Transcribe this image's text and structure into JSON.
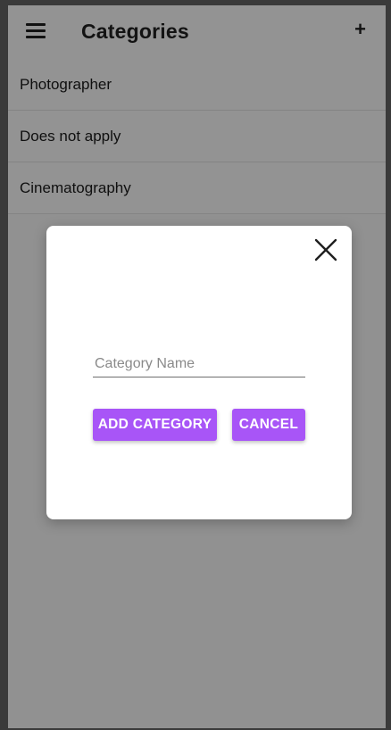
{
  "appbar": {
    "title": "Categories",
    "menu_icon": "hamburger-menu-icon",
    "add_icon_glyph": "+"
  },
  "categories": [
    {
      "label": "Photographer"
    },
    {
      "label": "Does not apply"
    },
    {
      "label": "Cinematography"
    }
  ],
  "dialog": {
    "close_icon": "close-icon",
    "input": {
      "value": "",
      "placeholder": "Category Name"
    },
    "add_button_label": "ADD CATEGORY",
    "cancel_button_label": "CANCEL"
  },
  "colors": {
    "accent": "#a855f7",
    "scrim": "rgba(0,0,0,0.40)",
    "surface": "#ffffff"
  }
}
